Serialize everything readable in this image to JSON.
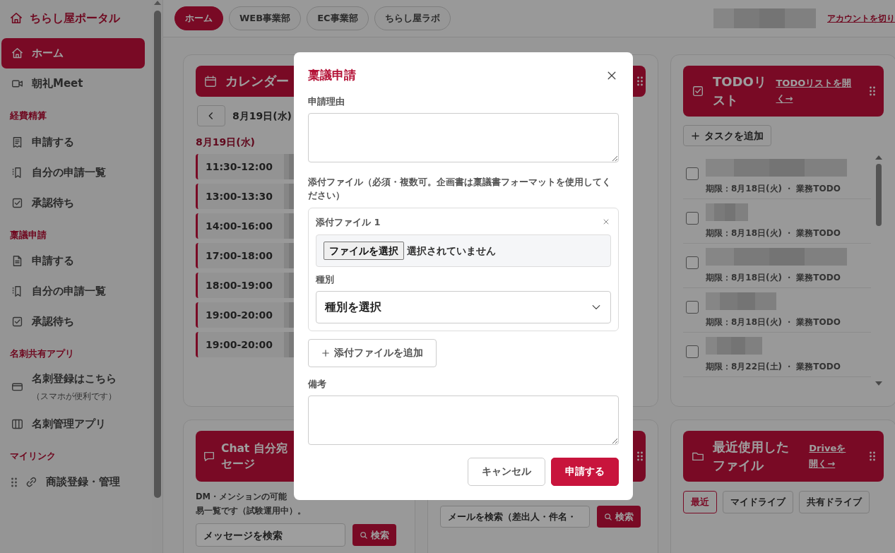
{
  "sidebar": {
    "brand": "ちらし屋ポータル",
    "nav": [
      {
        "label": "ホーム",
        "selected": true
      },
      {
        "label": "朝礼Meet",
        "selected": false
      }
    ],
    "groups": [
      {
        "title": "経費精算",
        "items": [
          {
            "label": "申請する",
            "selected": false
          },
          {
            "label": "自分の申請一覧",
            "selected": false
          },
          {
            "label": "承認待ち",
            "selected": false
          }
        ]
      },
      {
        "title": "稟議申請",
        "items": [
          {
            "label": "申請する",
            "selected": false
          },
          {
            "label": "自分の申請一覧",
            "selected": false
          },
          {
            "label": "承認待ち",
            "selected": false
          }
        ]
      },
      {
        "title": "名刺共有アプリ",
        "items": [
          {
            "label": "名刺登録はこちら",
            "note": "（スマホが便利です）",
            "selected": false
          },
          {
            "label": "名刺管理アプリ",
            "selected": false
          }
        ]
      },
      {
        "title": "マイリンク",
        "items": [
          {
            "label": "商談登録・管理",
            "selected": false
          }
        ]
      }
    ]
  },
  "top_tabs": [
    {
      "label": "ホーム",
      "selected": true
    },
    {
      "label": "WEB事業部",
      "selected": false
    },
    {
      "label": "EC事業部",
      "selected": false
    },
    {
      "label": "ちらし屋ラボ",
      "selected": false
    }
  ],
  "account": {
    "link": "アカウントを切り"
  },
  "calendar": {
    "title": "カレンダー",
    "date": "8月19日(水)",
    "day_heading": "8月19日(水)",
    "events": [
      {
        "time": "11:30-12:00"
      },
      {
        "time": "13:00-13:30"
      },
      {
        "time": "14:00-16:00"
      },
      {
        "time": "17:00-18:00"
      },
      {
        "time": "18:00-19:00"
      },
      {
        "time": "19:00-20:00"
      },
      {
        "time": "19:00-20:00"
      }
    ]
  },
  "chat": {
    "title_lines": [
      "Chat 自分宛",
      "セージ"
    ],
    "description_lines": [
      "DM・メンションの可能",
      "易一覧です（試験運用中）。"
    ],
    "search": {
      "placeholder": "メッセージを検索"
    },
    "search_button": "検索"
  },
  "mail": {
    "search": {
      "placeholder": "メールを検索（差出人・件名・"
    },
    "search_button": "検索"
  },
  "todo": {
    "title": "TODOリスト",
    "link": "TODOリストを開く→",
    "add_button": "タスクを追加",
    "tasks": [
      {
        "meta": "期限：8月18日(火) ・ 業務TODO",
        "checked": false
      },
      {
        "meta": "期限：8月18日(火) ・ 業務TODO",
        "checked": false
      },
      {
        "meta": "期限：8月18日(火) ・ 業務TODO",
        "checked": false
      },
      {
        "meta": "期限：8月18日(火) ・ 業務TODO",
        "checked": false
      },
      {
        "meta": "期限：8月22日(土) ・ 業務TODO",
        "checked": false
      }
    ]
  },
  "files": {
    "title": "最近使用したファイル",
    "link": "Driveを開く→",
    "tabs": [
      {
        "label": "最近",
        "selected": true
      },
      {
        "label": "マイドライブ",
        "selected": false
      },
      {
        "label": "共有ドライブ",
        "selected": false
      }
    ]
  },
  "modal": {
    "title": "稟議申請",
    "reason_label": "申請理由",
    "attach_label": "添付ファイル（必須・複数可。企画書は稟議書フォーマットを使用してください）",
    "attachments": [
      {
        "title": "添付ファイル 1",
        "file_button": "ファイルを選択",
        "file_status": "選択されていません",
        "type_label": "種別",
        "type_select": "種別を選択"
      }
    ],
    "add_attachment": "添付ファイルを追加",
    "notes_label": "備考",
    "buttons": [
      {
        "label": "キャンセル",
        "kind": "secondary"
      },
      {
        "label": "申請する",
        "kind": "primary"
      }
    ]
  }
}
